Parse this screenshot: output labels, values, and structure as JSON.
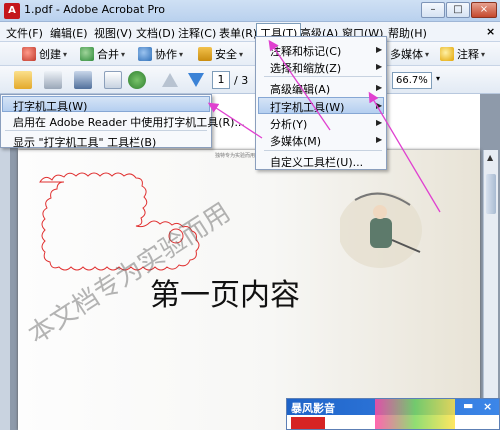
{
  "window": {
    "title": "1.pdf - Adobe Acrobat Pro",
    "minimize": "–",
    "maximize": "□",
    "close": "×"
  },
  "menubar": {
    "items": [
      "文件(F)",
      "编辑(E)",
      "视图(V)",
      "文档(D)",
      "注释(C)",
      "表单(R)",
      "工具(T)",
      "高级(A)",
      "窗口(W)",
      "帮助(H)"
    ],
    "doc_close": "×"
  },
  "toolbar1": {
    "create": "创建",
    "combine": "合并",
    "collaborate": "协作",
    "secure": "安全",
    "multimedia": "多媒体",
    "comment": "注释"
  },
  "toolbar2": {
    "page_current": "1",
    "page_total": "/ 3",
    "zoom": "66.7%"
  },
  "tools_menu": {
    "items": [
      "注释和标记(C)",
      "选择和缩放(Z)",
      "高级编辑(A)",
      "打字机工具(W)",
      "分析(Y)",
      "多媒体(M)",
      "自定义工具栏(U)..."
    ]
  },
  "typewriter_submenu": {
    "items": [
      "打字机工具(W)",
      "启用在 Adobe Reader 中使用打字机工具(R)...",
      "显示 \"打字机工具\" 工具栏(B)"
    ]
  },
  "document": {
    "small_header": "独特专为实验而用",
    "heading": "第一页内容",
    "watermark": "本文档专为实验而用"
  },
  "ad": {
    "brand": "暴风影音"
  },
  "colors": {
    "arrow": "#e040d0",
    "cloud": "#e03030",
    "highlight": "#b5cff0"
  }
}
